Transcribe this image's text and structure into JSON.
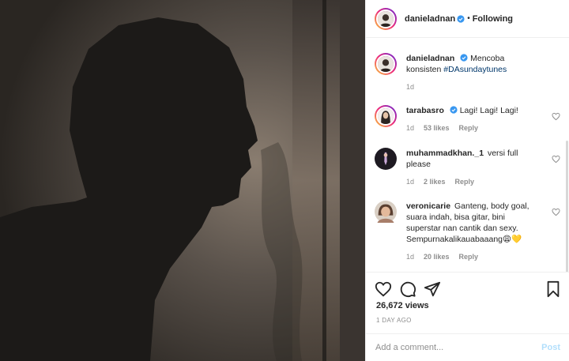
{
  "header": {
    "username": "danieladnan",
    "separator": "•",
    "follow_status": "Following"
  },
  "caption": {
    "username": "danieladnan",
    "text": "Mencoba konsisten",
    "hashtag": "#DAsundaytunes",
    "age": "1d"
  },
  "comments": [
    {
      "username": "tarabasro",
      "verified": true,
      "text": "Lagi! Lagi! Lagi!",
      "age": "1d",
      "likes": "53 likes",
      "reply": "Reply"
    },
    {
      "username": "muhammadkhan._1",
      "verified": false,
      "text": "versi full please",
      "age": "1d",
      "likes": "2 likes",
      "reply": "Reply"
    },
    {
      "username": "veronicarie",
      "verified": false,
      "text": "Ganteng, body goal, suara indah, bisa gitar, bini superstar nan cantik dan sexy. Sempurnakalikauabaaang😩💛",
      "age": "1d",
      "likes": "20 likes",
      "reply": "Reply"
    }
  ],
  "stats": {
    "views": "26,672 views",
    "posted": "1 DAY AGO"
  },
  "add_comment": {
    "placeholder": "Add a comment...",
    "post_label": "Post"
  },
  "icons": [
    "heart-icon",
    "comment-icon",
    "share-icon",
    "bookmark-icon",
    "verified-badge-icon"
  ],
  "colors": {
    "accent": "#0095f6",
    "post_disabled": "#b2dffc",
    "muted": "#8e8e8e",
    "link": "#00376b"
  }
}
